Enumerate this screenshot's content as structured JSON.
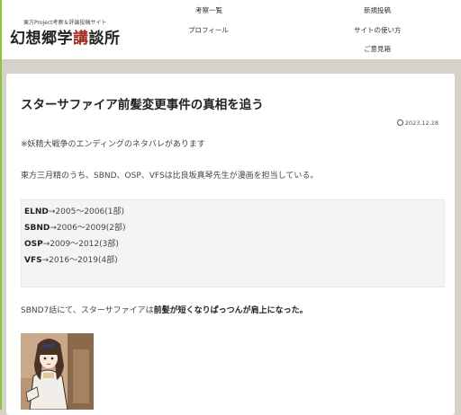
{
  "site": {
    "subtitle": "東方Project考察＆評論投稿サイト",
    "title_pre": "幻想郷学",
    "title_accent": "講",
    "title_post": "談所"
  },
  "nav": {
    "items": [
      "考察一覧",
      "新規投稿",
      "プロフィール",
      "サイトの使い方",
      "ご意見箱"
    ]
  },
  "post": {
    "title": "スターサファイア前髪変更事件の真相を追う",
    "date": "2023.12.28",
    "spoiler_note": "※妖精大戦争のエンディングのネタバレがあります",
    "intro": "東方三月精のうち、SBND、OSP、VFSは比良坂真琴先生が漫画を担当している。",
    "series_list": [
      {
        "code": "ELND",
        "text": "→2005〜2006(1部)"
      },
      {
        "code": "SBND",
        "text": "→2006〜2009(2部)"
      },
      {
        "code": "OSP",
        "text": "→2009〜2012(3部)"
      },
      {
        "code": "VFS",
        "text": "→2016〜2019(4部)"
      }
    ],
    "line2_pre": "SBND7話にて、スターサファイアは",
    "line2_bold": "前髪が短くなりぱっつんが肩上になった。"
  },
  "colors": {
    "background": "#d6d2ca",
    "accent_green": "#8cc63f",
    "logo_accent": "#a52a1f"
  }
}
